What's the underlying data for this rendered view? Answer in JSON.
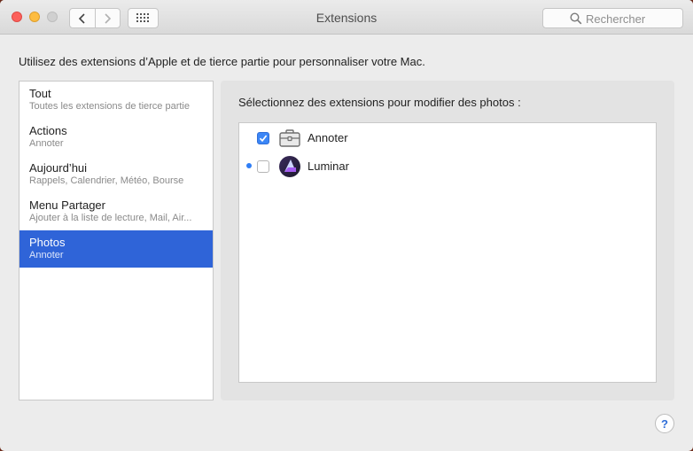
{
  "window": {
    "title": "Extensions"
  },
  "search": {
    "placeholder": "Rechercher"
  },
  "description": "Utilisez des extensions d’Apple et de tierce partie pour personnaliser votre Mac.",
  "sidebar": {
    "items": [
      {
        "label": "Tout",
        "subtitle": "Toutes les extensions de tierce partie"
      },
      {
        "label": "Actions",
        "subtitle": "Annoter"
      },
      {
        "label": "Aujourd’hui",
        "subtitle": "Rappels, Calendrier, Météo, Bourse"
      },
      {
        "label": "Menu Partager",
        "subtitle": "Ajouter à la liste de lecture, Mail, Air..."
      },
      {
        "label": "Photos",
        "subtitle": "Annoter",
        "selected": true
      }
    ]
  },
  "panel": {
    "heading": "Sélectionnez des extensions pour modifier des photos :",
    "extensions": [
      {
        "name": "Annoter",
        "checked": true,
        "new": false,
        "icon": "toolbox-icon"
      },
      {
        "name": "Luminar",
        "checked": false,
        "new": true,
        "icon": "luminar-icon"
      }
    ]
  },
  "help": {
    "label": "?"
  },
  "colors": {
    "selection": "#2f64d8",
    "checkbox": "#3b86f6",
    "new_dot": "#2f7ef6"
  }
}
